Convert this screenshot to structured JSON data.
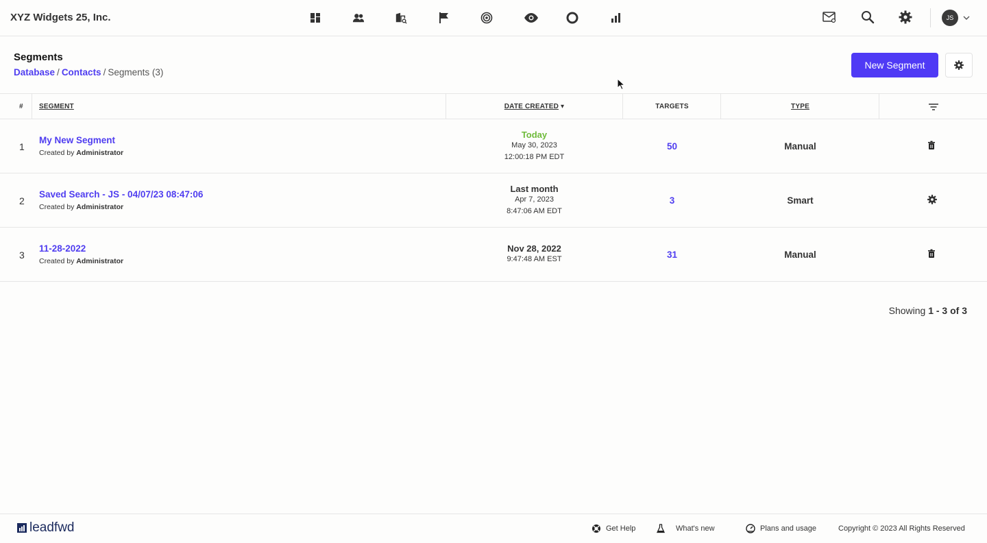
{
  "app": {
    "company_name": "XYZ Widgets 25, Inc.",
    "nav_icons": [
      "dashboard-icon",
      "contacts-icon",
      "accounts-icon",
      "campaigns-flag-icon",
      "targets-icon",
      "visitors-eye-icon",
      "circle-icon",
      "reports-bar-icon"
    ],
    "user_initials": "JS",
    "accent_color": "#4f3af5"
  },
  "header": {
    "title": "Segments",
    "breadcrumb": [
      "Database",
      "Contacts",
      "Segments (3)"
    ],
    "new_button": "New Segment"
  },
  "table": {
    "columns": {
      "num": "#",
      "segment": "SEGMENT",
      "date_created": "DATE CREATED",
      "sort_indicator": "▾",
      "targets": "TARGETS",
      "type": "TYPE"
    },
    "rows": [
      {
        "num": "1",
        "name": "My New Segment",
        "created_prefix": "Created by ",
        "created_by": "Administrator",
        "date_relative": "Today",
        "date": "May 30, 2023",
        "time": "12:00:18 PM EDT",
        "targets": "50",
        "type": "Manual",
        "action": "trash-icon"
      },
      {
        "num": "2",
        "name": "Saved Search - JS - 04/07/23 08:47:06",
        "created_prefix": "Created by ",
        "created_by": "Administrator",
        "date_relative": "Last month",
        "date": "Apr 7, 2023",
        "time": "8:47:06 AM EDT",
        "targets": "3",
        "type": "Smart",
        "action": "gear-icon"
      },
      {
        "num": "3",
        "name": "11-28-2022",
        "created_prefix": "Created by ",
        "created_by": "Administrator",
        "date_relative": "Nov 28, 2022",
        "time": "9:47:48 AM EST",
        "targets": "31",
        "type": "Manual",
        "action": "trash-icon"
      }
    ]
  },
  "pagination": {
    "prefix": "Showing ",
    "range": "1 - 3 of 3"
  },
  "footer": {
    "logo_text": "leadfwd",
    "get_help": "Get Help",
    "whats_new": "What's new",
    "plans": "Plans and usage",
    "copyright": "Copyright © 2023 All Rights Reserved"
  }
}
